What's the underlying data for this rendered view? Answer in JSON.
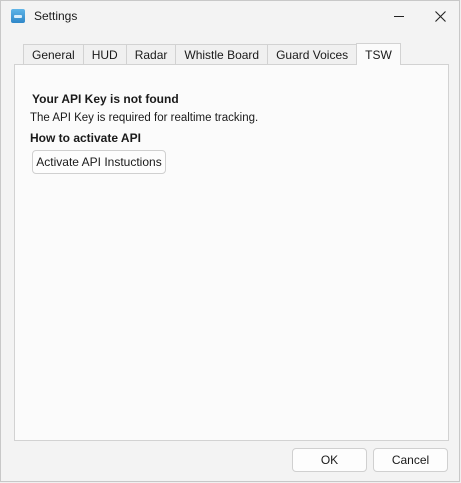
{
  "window": {
    "title": "Settings"
  },
  "tabs": [
    {
      "label": "General"
    },
    {
      "label": "HUD"
    },
    {
      "label": "Radar"
    },
    {
      "label": "Whistle Board"
    },
    {
      "label": "Guard Voices"
    },
    {
      "label": "TSW",
      "active": true
    }
  ],
  "panel": {
    "heading": "Your API Key is not found",
    "description": "The API Key is required for realtime tracking.",
    "subheading": "How to activate API",
    "activate_button": "Activate API Instuctions"
  },
  "footer": {
    "ok_label": "OK",
    "cancel_label": "Cancel"
  },
  "colors": {
    "accent": "#2f87c8"
  },
  "icons": {
    "app": "settings-app-icon",
    "minimize": "minimize-icon",
    "close": "close-icon"
  }
}
